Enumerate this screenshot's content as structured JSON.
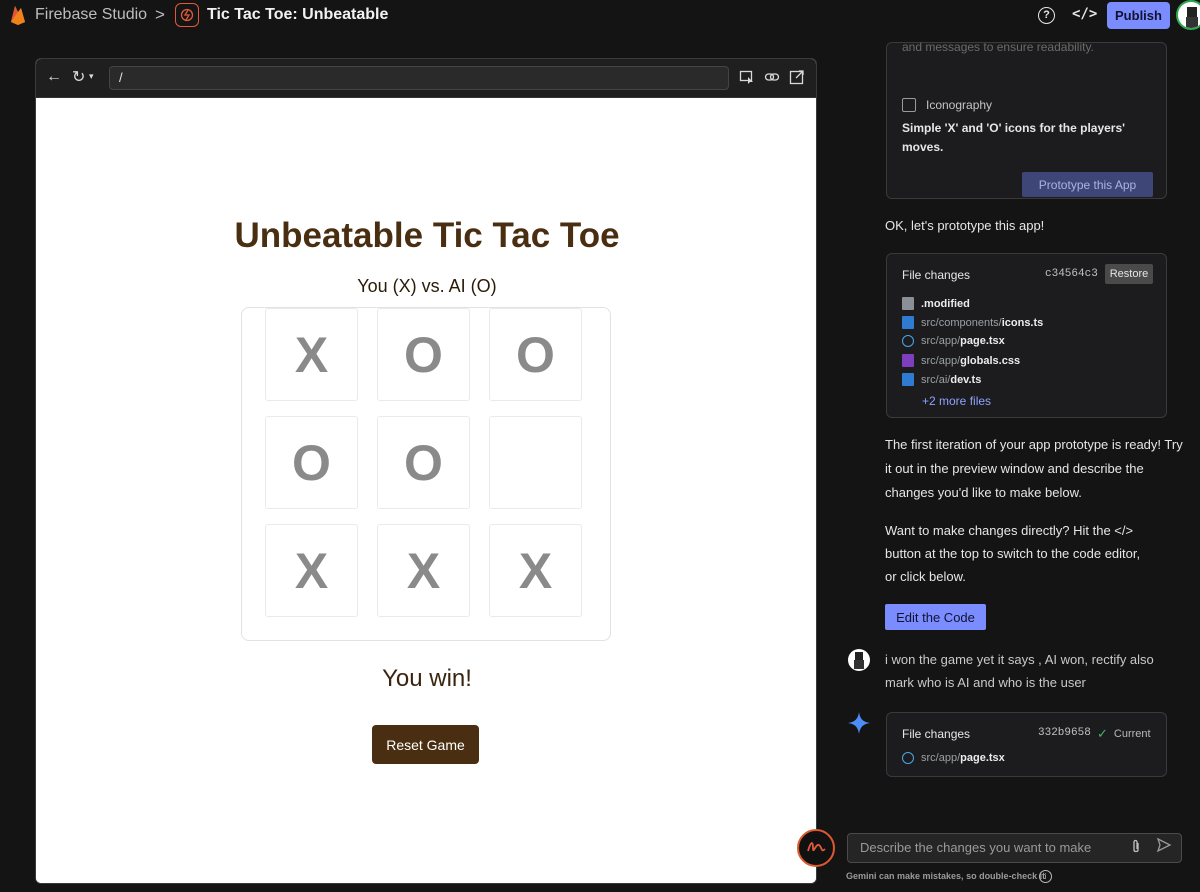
{
  "header": {
    "brand_name": "Firebase Studio",
    "separator": ">",
    "project_title": "Tic Tac Toe: Unbeatable",
    "publish_label": "Publish",
    "help_symbol": "?",
    "code_symbol": "</>"
  },
  "preview": {
    "url": "/",
    "back_symbol": "←",
    "reload_symbol": "↻",
    "game": {
      "title": "Unbeatable Tic Tac Toe",
      "subtitle": "You (X) vs. AI (O)",
      "cells": [
        "X",
        "O",
        "O",
        "O",
        "O",
        "",
        "X",
        "X",
        "X"
      ],
      "status": "You win!",
      "reset_label": "Reset Game"
    }
  },
  "chat": {
    "faded_text": "and messages to ensure readability.",
    "feature_label": "Iconography",
    "feature_desc": "Simple 'X' and 'O' icons for the players' moves.",
    "prototype_button": "Prototype this App",
    "msg_prototype": "OK, let's prototype this app!",
    "file_changes_1": {
      "title": "File changes",
      "hash": "c34564c3",
      "restore_label": "Restore",
      "files": [
        {
          "dir": "",
          "name": ".modified",
          "type": "gray"
        },
        {
          "dir": "src/components/",
          "name": "icons.ts",
          "type": "ts"
        },
        {
          "dir": "src/app/",
          "name": "page.tsx",
          "type": "react"
        },
        {
          "dir": "src/app/",
          "name": "globals.css",
          "type": "css"
        },
        {
          "dir": "src/ai/",
          "name": "dev.ts",
          "type": "ts"
        }
      ],
      "more_files": "+2 more files"
    },
    "msg_iteration": "The first iteration of your app prototype is ready! Try it out in the preview window and describe the changes you'd like to make below.",
    "msg_direct_1": "Want to make changes directly? Hit the </>",
    "msg_direct_2": "button at the top to switch to the code editor,",
    "msg_direct_3": "or click below.",
    "edit_code_label": "Edit the Code",
    "user_message": "i won the game yet it says , AI won, rectify also mark who is AI and who is the user",
    "file_changes_2": {
      "title": "File changes",
      "hash": "332b9658",
      "current_label": "Current",
      "files": [
        {
          "dir": "src/app/",
          "name": "page.tsx",
          "type": "react"
        }
      ]
    },
    "input_placeholder": "Describe the changes you want to make",
    "disclaimer": "Gemini can make mistakes, so double-check it"
  },
  "colors": {
    "accent": "#7b8cff",
    "game_brown": "#4a2e12",
    "background": "#141414"
  }
}
